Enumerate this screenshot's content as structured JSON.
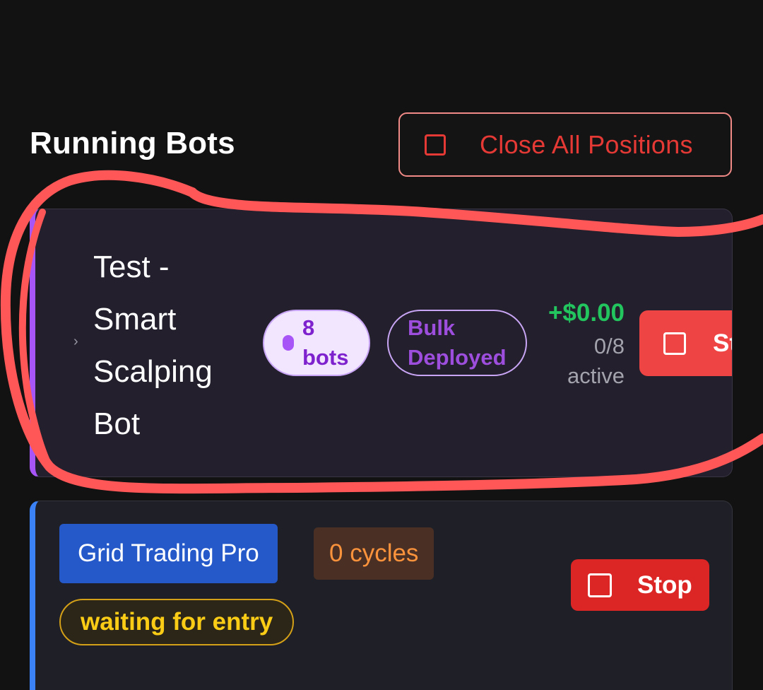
{
  "header": {
    "title": "Running Bots",
    "close_all_label": "Close All Positions"
  },
  "bot_group": {
    "name": "Test - Smart Scalping Bot",
    "bots_badge": "8 bots",
    "deployment_badge": "Bulk Deployed",
    "pnl": "+$0.00",
    "active_count": "0/8 active",
    "stop_label": "St",
    "accent_color": "#a855f7"
  },
  "bot_card": {
    "strategy_badge": "Grid Trading Pro",
    "cycles_badge": "0 cycles",
    "status_badge": "waiting for entry",
    "stop_label": "Stop",
    "accent_color": "#3b82f6"
  },
  "colors": {
    "background": "#121212",
    "danger": "#e53935",
    "profit": "#22c55e",
    "annotation": "#ff4d4d"
  },
  "icons": {
    "expand": "chevron-right-icon",
    "stop": "square-stop-icon"
  }
}
